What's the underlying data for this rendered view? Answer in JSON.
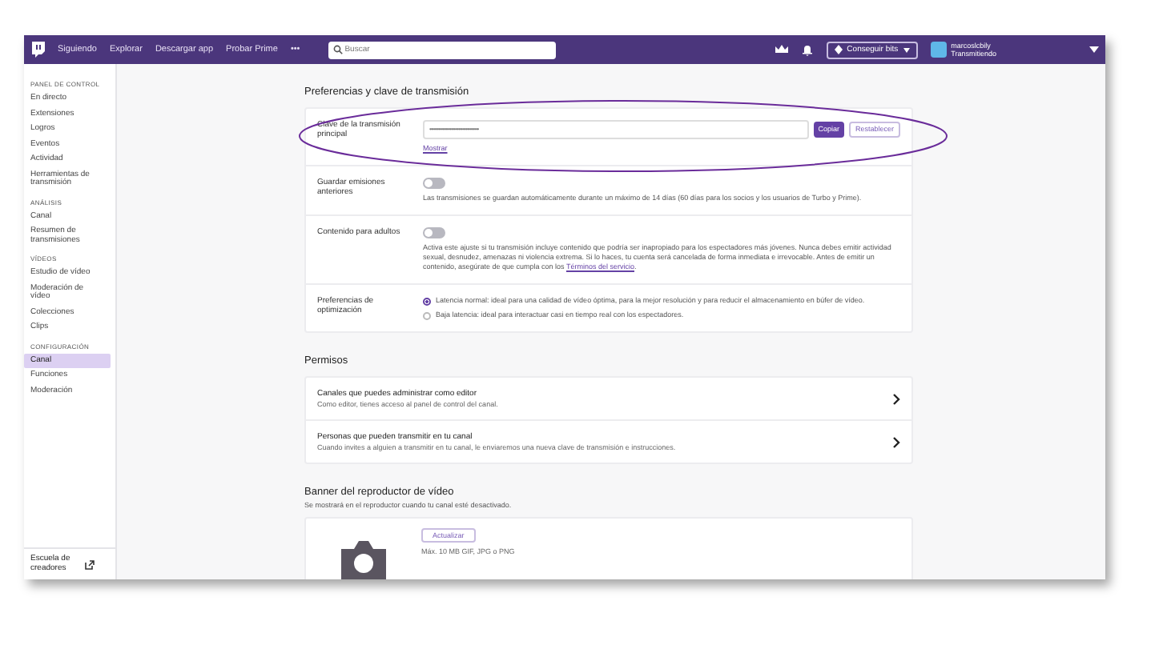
{
  "topbar": {
    "nav": [
      "Siguiendo",
      "Explorar",
      "Descargar app",
      "Probar Prime",
      "•••"
    ],
    "search": {
      "placeholder": "Buscar"
    },
    "bits_button": "Conseguir bits",
    "user": {
      "name": "marcoslcbily",
      "status": "Transmitiendo"
    }
  },
  "sidebar": {
    "sections": [
      {
        "heading": "PANEL DE CONTROL",
        "items": [
          {
            "label": "En directo",
            "selected": false
          },
          {
            "label": "Extensiones",
            "selected": false
          },
          {
            "label": "Logros",
            "selected": false
          },
          {
            "label": "Eventos",
            "selected": false
          },
          {
            "label": "Actividad",
            "selected": false
          },
          {
            "label": "Herramientas de transmisión",
            "selected": false
          }
        ]
      },
      {
        "heading": "ANÁLISIS",
        "items": [
          {
            "label": "Canal",
            "selected": false
          },
          {
            "label": "Resumen de transmisiones",
            "selected": false
          }
        ]
      },
      {
        "heading": "VÍDEOS",
        "items": [
          {
            "label": "Estudio de vídeo",
            "selected": false
          },
          {
            "label": "Moderación de vídeo",
            "selected": false
          },
          {
            "label": "Colecciones",
            "selected": false
          },
          {
            "label": "Clips",
            "selected": false
          }
        ]
      },
      {
        "heading": "CONFIGURACIÓN",
        "items": [
          {
            "label": "Canal",
            "selected": true
          },
          {
            "label": "Funciones",
            "selected": false
          },
          {
            "label": "Moderación",
            "selected": false
          }
        ]
      }
    ],
    "footer": "Escuela de creadores"
  },
  "stream": {
    "title": "Preferencias y clave de transmisión",
    "rows": [
      {
        "kind": "key",
        "label": "Clave de la transmisión principal",
        "value": "••••••••••••••••••••••••••••••••••",
        "copy": "Copiar",
        "reset": "Restablecer",
        "show": "Mostrar"
      },
      {
        "kind": "toggle",
        "label": "Guardar emisiones anteriores",
        "on": false,
        "description": "Las transmisiones se guardan automáticamente durante un máximo de 14 días (60 días para los socios y los usuarios de Turbo y Prime)."
      },
      {
        "kind": "toggle",
        "label": "Contenido para adultos",
        "on": false,
        "description": "Activa este ajuste si tu transmisión incluye contenido que podría ser inapropiado para los espectadores más jóvenes. Nunca debes emitir actividad sexual, desnudez, amenazas ni violencia extrema. Si lo haces, tu cuenta será cancelada de forma inmediata e irrevocable. Antes de emitir un contenido, asegúrate de que cumpla con los",
        "link": "Términos del servicio",
        "suffix": "."
      },
      {
        "kind": "radio",
        "label": "Preferencias de optimización",
        "options": [
          {
            "label": "Latencia normal: ideal para una calidad de vídeo óptima, para la mejor resolución y para reducir el almacenamiento en búfer de vídeo.",
            "selected": true
          },
          {
            "label": "Baja latencia: ideal para interactuar casi en tiempo real con los espectadores.",
            "selected": false
          }
        ]
      }
    ]
  },
  "permissions": {
    "title": "Permisos",
    "rows": [
      {
        "title": "Canales que puedes administrar como editor",
        "description": "Como editor, tienes acceso al panel de control del canal."
      },
      {
        "title": "Personas que pueden transmitir en tu canal",
        "description": "Cuando invites a alguien a transmitir en tu canal, le enviaremos una nueva clave de transmisión e instrucciones."
      }
    ]
  },
  "banner": {
    "title": "Banner del reproductor de vídeo",
    "subtitle": "Se mostrará en el reproductor cuando tu canal esté desactivado.",
    "button": "Actualizar",
    "note": "Máx. 10 MB GIF, JPG o PNG"
  }
}
